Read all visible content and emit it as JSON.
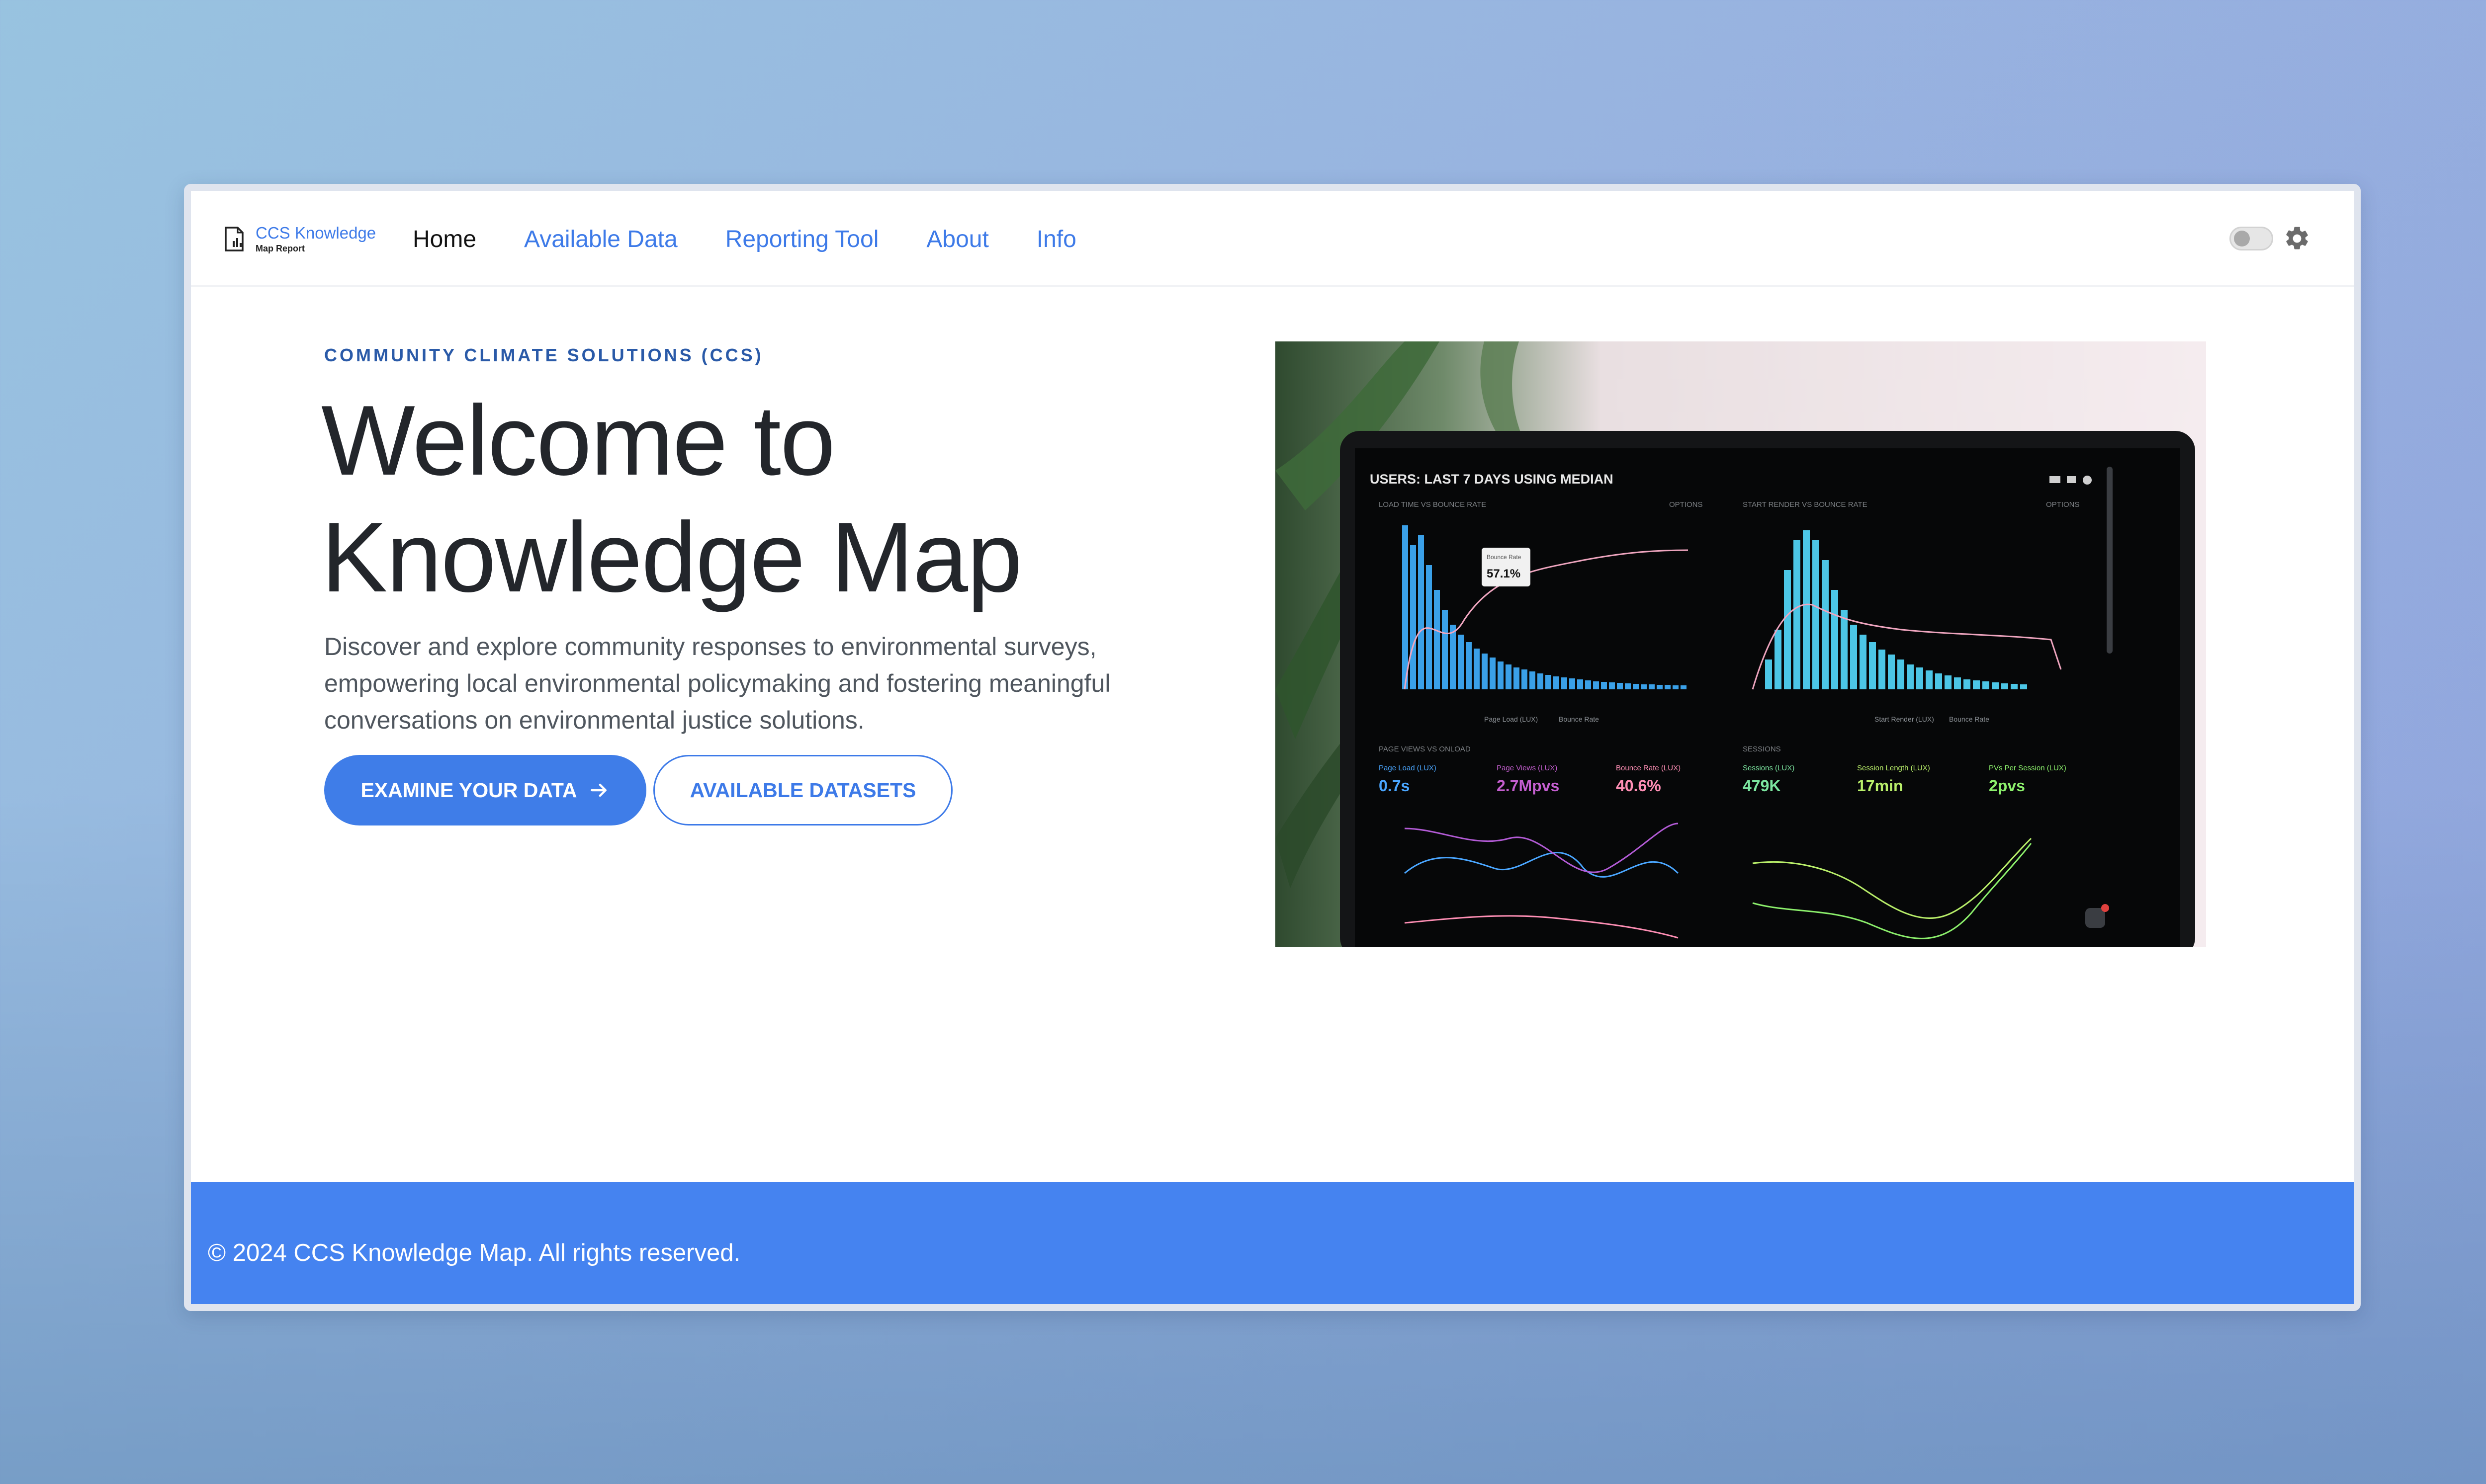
{
  "brand": {
    "title": "CCS Knowledge",
    "subtitle": "Map Report",
    "icon": "document-chart-icon"
  },
  "nav": {
    "items": [
      {
        "label": "Home",
        "active": true
      },
      {
        "label": "Available Data",
        "active": false
      },
      {
        "label": "Reporting Tool",
        "active": false
      },
      {
        "label": "About",
        "active": false
      },
      {
        "label": "Info",
        "active": false
      }
    ],
    "theme_toggle": {
      "state": "off",
      "icon": "toggle-switch"
    },
    "settings_icon": "gear-icon"
  },
  "hero": {
    "eyebrow": "COMMUNITY CLIMATE SOLUTIONS (CCS)",
    "headline": "Welcome to Knowledge Map",
    "description": "Discover and explore community responses to environmental surveys, empowering local environmental policymaking and fostering meaningful conversations on environmental justice solutions.",
    "primary_button": {
      "label": "EXAMINE YOUR DATA",
      "icon": "arrow-right-icon"
    },
    "secondary_button": {
      "label": "AVAILABLE DATASETS"
    }
  },
  "photo_screen": {
    "header": "USERS: LAST 7 DAYS USING MEDIAN",
    "panel_1_title": "LOAD TIME VS BOUNCE RATE",
    "panel_2_title": "START RENDER VS BOUNCE RATE",
    "options_label": "OPTIONS",
    "tooltip_label": "Bounce Rate",
    "tooltip_value": "57.1%",
    "legend_1": "Page Load (LUX)",
    "legend_2": "Bounce Rate",
    "legend_3": "Start Render (LUX)",
    "panel_3_title": "PAGE VIEWS VS ONLOAD",
    "panel_4_title": "SESSIONS",
    "metrics": [
      {
        "label": "Page Load (LUX)",
        "value": "0.7s",
        "color": "#4aa6ff"
      },
      {
        "label": "Page Views (LUX)",
        "value": "2.7Mpvs",
        "color": "#c45ecf"
      },
      {
        "label": "Bounce Rate (LUX)",
        "value": "40.6%",
        "color": "#ff8fb5"
      },
      {
        "label": "Sessions (LUX)",
        "value": "479K",
        "color": "#7ce6a0"
      },
      {
        "label": "Session Length (LUX)",
        "value": "17min",
        "color": "#b9ef6a"
      },
      {
        "label": "PVs Per Session (LUX)",
        "value": "2pvs",
        "color": "#8cf06c"
      }
    ]
  },
  "footer": {
    "text": "© 2024 CCS Knowledge Map. All rights reserved."
  },
  "colors": {
    "accent": "#3f7de8",
    "footer_bg": "#4583f0",
    "heading": "#23262b",
    "eyebrow": "#2a5aa8"
  }
}
